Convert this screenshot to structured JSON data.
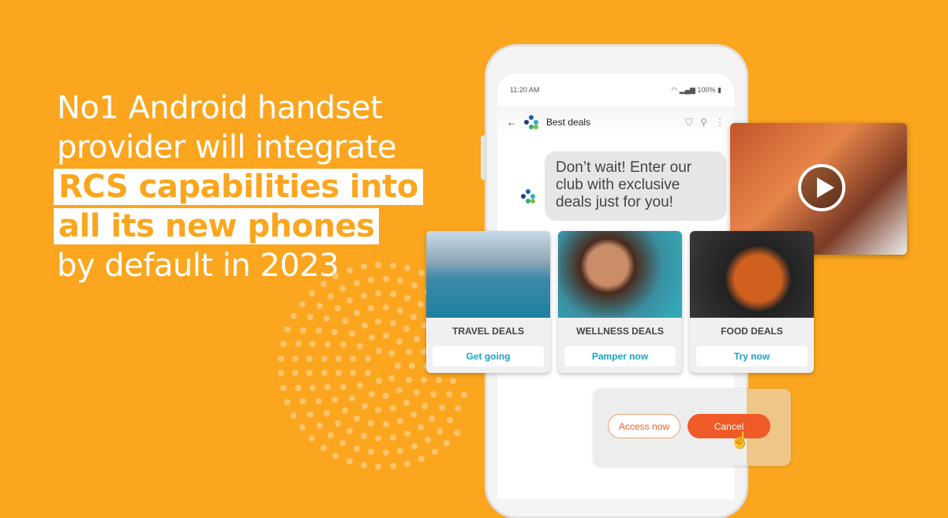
{
  "headline": {
    "line1": "No1 Android handset",
    "line2": "provider will integrate",
    "line3": "RCS capabilities into",
    "line4": "all its new phones",
    "line5": "by default in 2023"
  },
  "phone": {
    "status": {
      "time": "11:20 AM",
      "battery": "100%",
      "icons": [
        "wifi-icon",
        "signal-icon",
        "battery-icon"
      ]
    },
    "app_bar": {
      "title": "Best deals",
      "icons": [
        "back-arrow-icon",
        "verified-shield-icon",
        "search-icon",
        "more-vert-icon"
      ]
    },
    "message": "Don’t wait! Enter our club with exclusive deals just for you!",
    "cards": [
      {
        "title": "TRAVEL DEALS",
        "action": "Get going"
      },
      {
        "title": "WELLNESS DEALS",
        "action": "Pamper now"
      },
      {
        "title": "FOOD DEALS",
        "action": "Try now"
      }
    ],
    "replies": {
      "access": "Access now",
      "cancel": "Cancel"
    }
  },
  "colors": {
    "background": "#FBA61E",
    "accent": "#F05A28",
    "link": "#1AA3C8"
  }
}
